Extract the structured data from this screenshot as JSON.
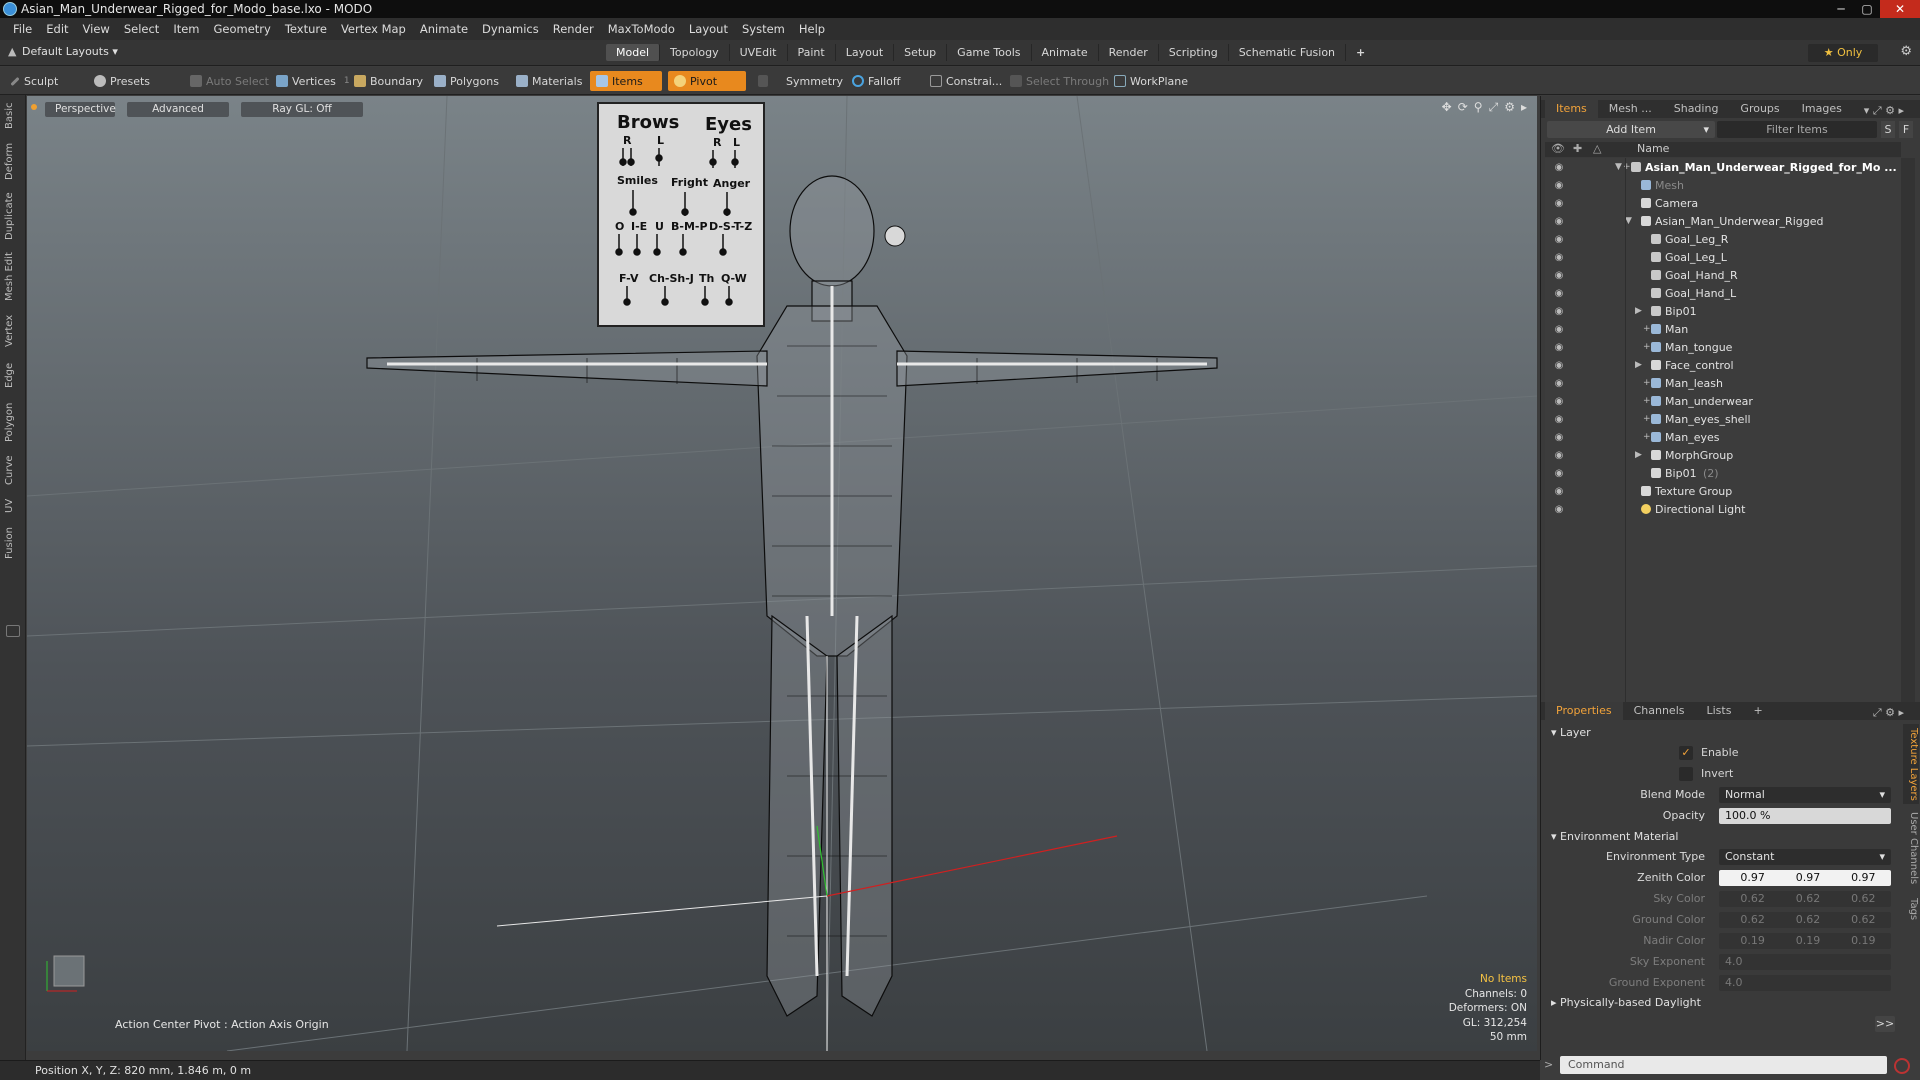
{
  "window": {
    "title": "Asian_Man_Underwear_Rigged_for_Modo_base.lxo - MODO"
  },
  "menu": [
    "File",
    "Edit",
    "View",
    "Select",
    "Item",
    "Geometry",
    "Texture",
    "Vertex Map",
    "Animate",
    "Dynamics",
    "Render",
    "MaxToModo",
    "Layout",
    "System",
    "Help"
  ],
  "layoutbar": {
    "layout_select": "Default Layouts",
    "tabs": [
      "Model",
      "Topology",
      "UVEdit",
      "Paint",
      "Layout",
      "Setup",
      "Game Tools",
      "Animate",
      "Render",
      "Scripting",
      "Schematic Fusion"
    ],
    "active_tab": "Model",
    "only_label": "Only"
  },
  "toolbar": {
    "sculpt": "Sculpt",
    "presets": "Presets",
    "auto_select": "Auto Select",
    "vertices": "Vertices",
    "vertices_count": "1",
    "boundary": "Boundary",
    "polygons": "Polygons",
    "materials": "Materials",
    "items": "Items",
    "pivot": "Pivot",
    "symmetry": "Symmetry",
    "falloff": "Falloff",
    "constraint": "Constrai...",
    "select_through": "Select Through",
    "workplane": "WorkPlane"
  },
  "left_tabs": [
    "Basic",
    "Deform",
    "Duplicate",
    "Mesh Edit",
    "Vertex",
    "Edge",
    "Polygon",
    "Curve",
    "UV",
    "Fusion"
  ],
  "viewport": {
    "view_mode": "Perspective",
    "shading": "Advanced",
    "raygl": "Ray GL: Off",
    "action_center": "Action Center Pivot : Action Axis Origin",
    "stats": {
      "selection": "No Items",
      "channels": "Channels: 0",
      "deformers": "Deformers: ON",
      "gl": "GL: 312,254",
      "focal": "50 mm"
    },
    "face_panel": {
      "brows": "Brows",
      "eyes": "Eyes",
      "brow_r": "R",
      "brow_l": "L",
      "eye_r": "R",
      "eye_l": "L",
      "smiles": "Smiles",
      "fright": "Fright",
      "anger": "Anger",
      "o": "O",
      "i_e": "I-E",
      "u": "U",
      "bmp": "B-M-P",
      "dstz": "D-S-T-Z",
      "fv": "F-V",
      "chshj": "Ch-Sh-J",
      "th": "Th",
      "qw": "Q-W"
    }
  },
  "items_panel": {
    "tabs": [
      "Items",
      "Mesh ...",
      "Shading",
      "Groups",
      "Images"
    ],
    "active_tab": "Items",
    "add_item": "Add Item",
    "filter_placeholder": "Filter Items",
    "s_btn": "S",
    "f_btn": "F",
    "column_name": "Name",
    "rows": [
      {
        "label": "Asian_Man_Underwear_Rigged_for_Mo ...",
        "indent": 0,
        "bold": true,
        "expand": "▼",
        "plus": true,
        "icon": "scene-icon"
      },
      {
        "label": "Mesh",
        "indent": 1,
        "muted": true,
        "icon": "mesh-icon"
      },
      {
        "label": "Camera",
        "indent": 1,
        "icon": "camera-icon"
      },
      {
        "label": "Asian_Man_Underwear_Rigged",
        "indent": 1,
        "expand": "▼",
        "icon": "group-icon"
      },
      {
        "label": "Goal_Leg_R",
        "indent": 2,
        "icon": "locator-icon"
      },
      {
        "label": "Goal_Leg_L",
        "indent": 2,
        "icon": "locator-icon"
      },
      {
        "label": "Goal_Hand_R",
        "indent": 2,
        "icon": "locator-icon"
      },
      {
        "label": "Goal_Hand_L",
        "indent": 2,
        "icon": "locator-icon"
      },
      {
        "label": "Bip01",
        "indent": 2,
        "expand": "▶",
        "icon": "locator-icon"
      },
      {
        "label": "Man",
        "indent": 2,
        "plus": true,
        "icon": "mesh-icon"
      },
      {
        "label": "Man_tongue",
        "indent": 2,
        "plus": true,
        "icon": "mesh-icon"
      },
      {
        "label": "Face_control",
        "indent": 2,
        "expand": "▶",
        "icon": "group-icon"
      },
      {
        "label": "Man_leash",
        "indent": 2,
        "plus": true,
        "icon": "mesh-icon"
      },
      {
        "label": "Man_underwear",
        "indent": 2,
        "plus": true,
        "icon": "mesh-icon"
      },
      {
        "label": "Man_eyes_shell",
        "indent": 2,
        "plus": true,
        "icon": "mesh-icon"
      },
      {
        "label": "Man_eyes",
        "indent": 2,
        "plus": true,
        "icon": "mesh-icon"
      },
      {
        "label": "MorphGroup",
        "indent": 2,
        "expand": "▶",
        "icon": "group-icon"
      },
      {
        "label": "Bip01",
        "suffix": "(2)",
        "indent": 2,
        "icon": "group-icon"
      },
      {
        "label": "Texture Group",
        "indent": 1,
        "icon": "group-icon"
      },
      {
        "label": "Directional Light",
        "indent": 1,
        "icon": "light-icon"
      }
    ]
  },
  "properties_panel": {
    "tabs": [
      "Properties",
      "Channels",
      "Lists"
    ],
    "active_tab": "Properties",
    "side_tabs": [
      "Texture Layers",
      "User Channels",
      "Tags"
    ],
    "layer_section": "Layer",
    "enable_label": "Enable",
    "enable_checked": true,
    "invert_label": "Invert",
    "invert_checked": false,
    "blend_mode_label": "Blend Mode",
    "blend_mode_value": "Normal",
    "opacity_label": "Opacity",
    "opacity_value": "100.0 %",
    "env_section": "Environment Material",
    "env_type_label": "Environment Type",
    "env_type_value": "Constant",
    "zenith_label": "Zenith Color",
    "zenith": [
      "0.97",
      "0.97",
      "0.97"
    ],
    "sky_label": "Sky Color",
    "sky": [
      "0.62",
      "0.62",
      "0.62"
    ],
    "ground_label": "Ground Color",
    "ground": [
      "0.62",
      "0.62",
      "0.62"
    ],
    "nadir_label": "Nadir Color",
    "nadir": [
      "0.19",
      "0.19",
      "0.19"
    ],
    "sky_exp_label": "Sky Exponent",
    "sky_exp_value": "4.0",
    "ground_exp_label": "Ground Exponent",
    "ground_exp_value": "4.0",
    "daylight_section": "Physically-based Daylight",
    "more_btn": ">>"
  },
  "command": {
    "placeholder": "Command"
  },
  "status": {
    "position": "Position X, Y, Z:  820 mm, 1.846 m, 0 m"
  },
  "colors": {
    "accent": "#e8891e",
    "active_tab_text": "#f2a33a",
    "selection_text": "#f5c243"
  }
}
